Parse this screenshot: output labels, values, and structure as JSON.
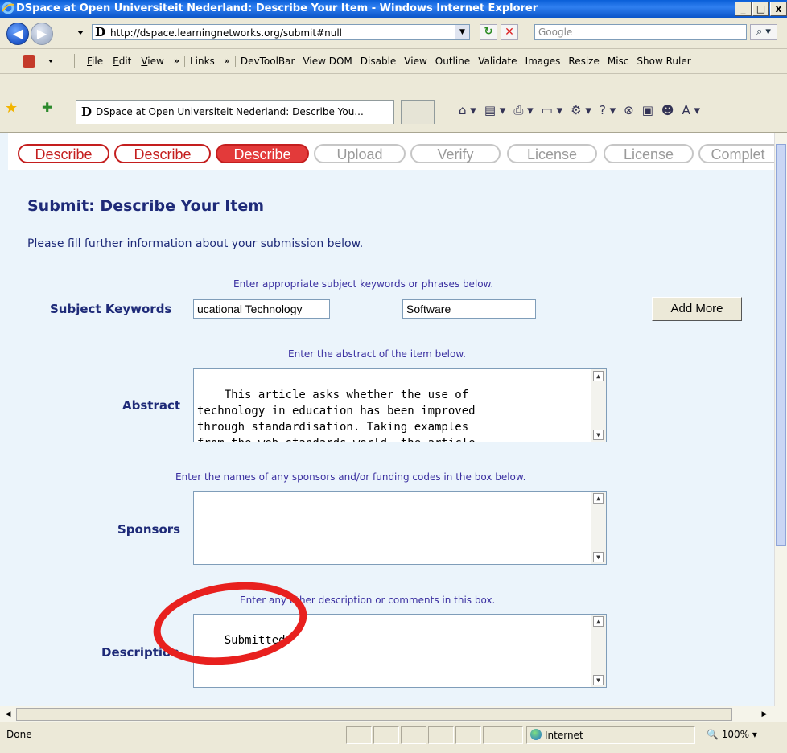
{
  "window": {
    "title": "DSpace at Open Universiteit Nederland: Describe Your Item - Windows Internet Explorer",
    "buttons": [
      "_",
      "□",
      "x"
    ]
  },
  "address_bar": {
    "url": "http://dspace.learningnetworks.org/submit#null",
    "search_placeholder": "Google"
  },
  "menu": {
    "items": [
      {
        "accel": "F",
        "rest": "ile"
      },
      {
        "accel": "E",
        "rest": "dit"
      },
      {
        "accel": "V",
        "rest": "iew"
      }
    ],
    "chevron1": "»",
    "links_label": "Links",
    "chevron2": "»",
    "toolbar_items": [
      "DevToolBar",
      "View DOM",
      "Disable",
      "View",
      "Outline",
      "Validate",
      "Images",
      "Resize",
      "Misc",
      "Show Ruler"
    ]
  },
  "tab": {
    "title": "DSpace at Open Universiteit Nederland: Describe You..."
  },
  "progress_steps": [
    {
      "label": "Describe",
      "state": "done"
    },
    {
      "label": "Describe",
      "state": "done"
    },
    {
      "label": "Describe",
      "state": "current"
    },
    {
      "label": "Upload",
      "state": "todo"
    },
    {
      "label": "Verify",
      "state": "todo"
    },
    {
      "label": "License",
      "state": "todo"
    },
    {
      "label": "License",
      "state": "todo"
    },
    {
      "label": "Complet",
      "state": "todo"
    }
  ],
  "page": {
    "title": "Submit: Describe Your Item",
    "intro": "Please fill further information about your submission below."
  },
  "form": {
    "subject": {
      "hint": "Enter appropriate subject keywords or phrases below.",
      "label": "Subject Keywords",
      "value1": "ucational Technology",
      "value2": "Software",
      "add_more": "Add More"
    },
    "abstract": {
      "hint": "Enter the abstract of the item below.",
      "label": "Abstract",
      "text": "This article asks whether the use of\ntechnology in education has been improved\nthrough standardisation. Taking examples\nfrom the web standards world, the article"
    },
    "sponsors": {
      "hint": "Enter the names of any sponsors and/or funding codes in the box below.",
      "label": "Sponsors",
      "text": ""
    },
    "description": {
      "hint": "Enter any other description or comments in this box.",
      "label": "Description",
      "text": "Submitted"
    }
  },
  "status_bar": {
    "text": "Done",
    "zone": "Internet",
    "zoom": "100%"
  },
  "colors": {
    "heading": "#1e2a78",
    "hint": "#3a2fa0",
    "accent_red": "#e33a3a",
    "annotation_circle": "#e8201e",
    "page_bg": "#ebf4fb"
  }
}
